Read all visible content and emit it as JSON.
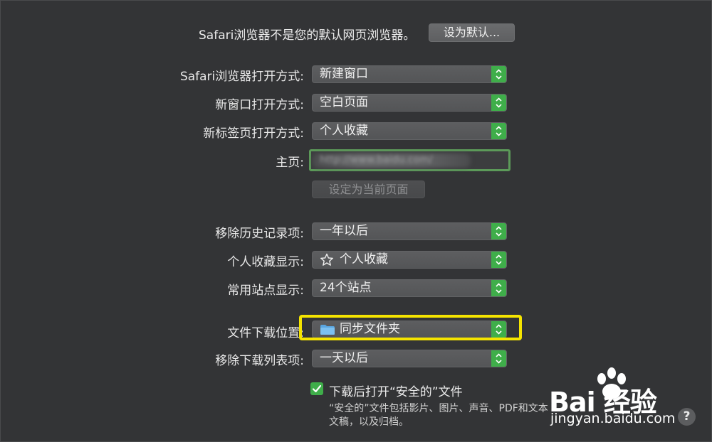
{
  "general": {
    "default_browser_message": "Safari浏览器不是您的默认网页浏览器。",
    "set_default_button": "设为默认...",
    "rows": [
      {
        "label": "Safari浏览器打开方式:",
        "value": "新建窗口"
      },
      {
        "label": "新窗口打开方式:",
        "value": "空白页面"
      },
      {
        "label": "新标签页打开方式:",
        "value": "个人收藏"
      }
    ],
    "homepage": {
      "label": "主页:",
      "value": "http://www.baidu.com/"
    },
    "set_current_page_button": "设定为当前页面",
    "history_rows": [
      {
        "label": "移除历史记录项:",
        "value": "一年以后"
      },
      {
        "label": "个人收藏显示:",
        "value": "个人收藏",
        "icon": "star-icon"
      },
      {
        "label": "常用站点显示:",
        "value": "24个站点"
      }
    ],
    "download_location": {
      "label": "文件下载位置:",
      "value": "同步文件夹",
      "icon": "folder-icon"
    },
    "remove_downloads": {
      "label": "移除下载列表项:",
      "value": "一天以后"
    },
    "open_safe_files": {
      "label": "下载后打开“安全的”文件",
      "checked": true
    },
    "safe_files_note": "“安全的”文件包括影片、图片、声音、PDF和文本文稿，以及归档。"
  },
  "watermark": {
    "logo": "Bai 经验",
    "url": "jingyan.baidu.com"
  },
  "help": "?",
  "colors": {
    "background": "#333436",
    "accent_green": "#3fae4a",
    "highlight_yellow": "#f5e400"
  }
}
